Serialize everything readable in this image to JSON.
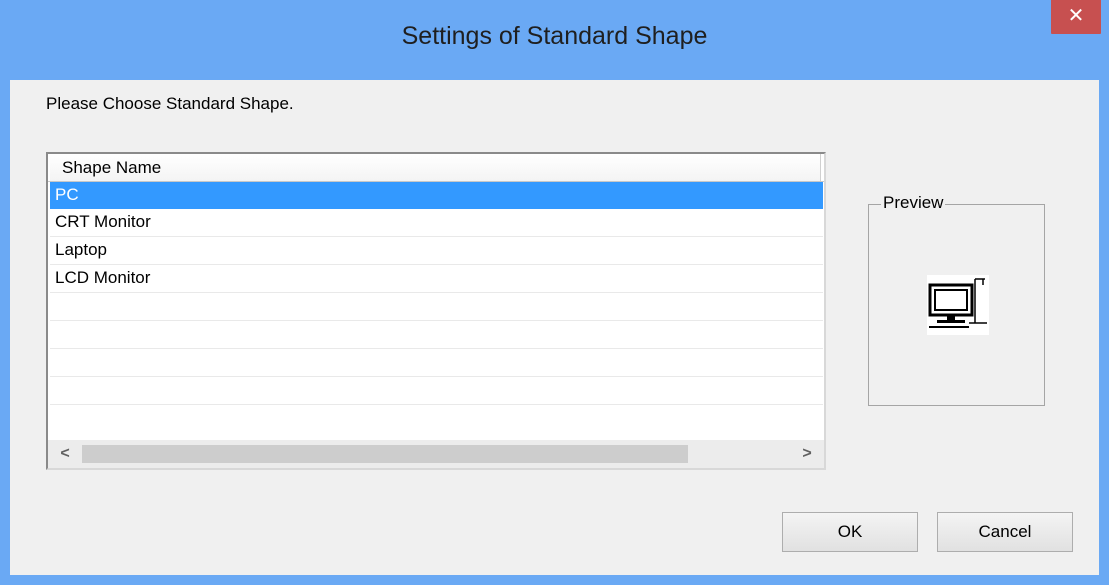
{
  "window": {
    "title": "Settings of Standard Shape",
    "close_glyph": "✕",
    "title_bar_color": "#6aa9f4",
    "close_button_color": "#c75050"
  },
  "prompt": "Please Choose Standard Shape.",
  "list": {
    "column_header": "Shape Name",
    "items": [
      "PC",
      "CRT Monitor",
      "Laptop",
      "LCD Monitor"
    ],
    "selected_index": 0,
    "selection_color": "#3399ff"
  },
  "scrollbar": {
    "left_arrow": "<",
    "right_arrow": ">"
  },
  "preview": {
    "label": "Preview",
    "icon": "pc-icon"
  },
  "buttons": {
    "ok": "OK",
    "cancel": "Cancel"
  }
}
